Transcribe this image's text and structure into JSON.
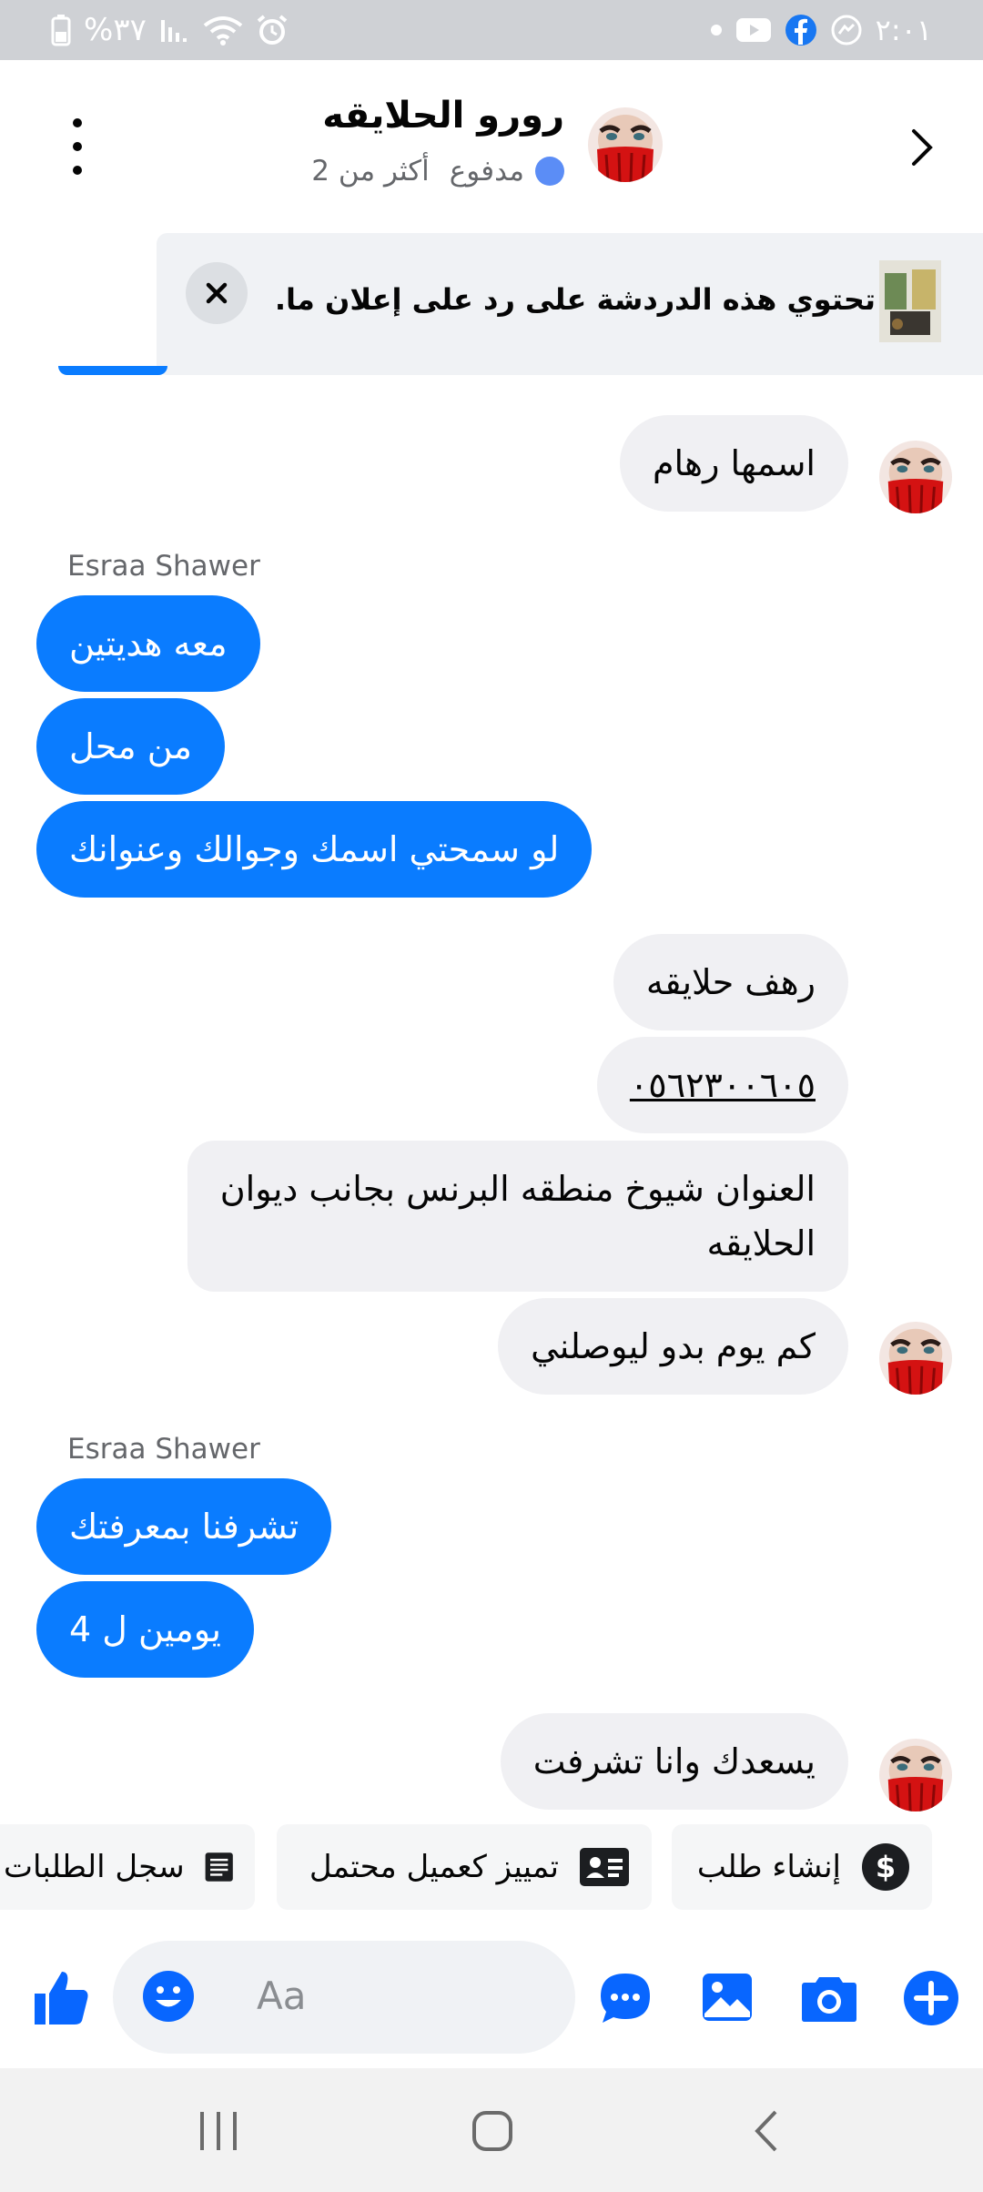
{
  "status_bar": {
    "battery": "%٣٧",
    "time": "٢:٠١"
  },
  "header": {
    "title": "رورو الحلايقه",
    "paid_label": "مدفوع",
    "more_label": "أكثر من 2"
  },
  "ad_banner": {
    "text": "تحتوي هذه الدردشة على رد على إعلان ما."
  },
  "messages": {
    "m1": "اسمها رهام",
    "sender1": "Esraa Shawer",
    "m2": "معه هديتين",
    "m3": "من محل",
    "m4": "لو سمحتي اسمك وجوالك وعنوانك",
    "m5": "رهف حلايقه",
    "m6": "٠٥٦٢٣٠٠٦٠٥",
    "m7_line1": "العنوان شيوخ منطقه البرنس بجانب ديوان",
    "m7_line2": "الحلايقه",
    "m8": "كم يوم بدو ليوصلني",
    "sender2": "Esraa Shawer",
    "m9": "تشرفنا بمعرفتك",
    "m10": "يومين ل 4",
    "m11": "يسعدك وانا تشرفت"
  },
  "quick_replies": {
    "create_order": "إنشاء طلب",
    "mark_lead": "تمييز كعميل محتمل",
    "order_history": "سجل الطلبات"
  },
  "composer": {
    "placeholder": "Aa"
  },
  "colors": {
    "messenger_blue": "#0a7cff",
    "incoming_bubble": "#f0f0f3",
    "icon_blue": "#0866ff"
  }
}
